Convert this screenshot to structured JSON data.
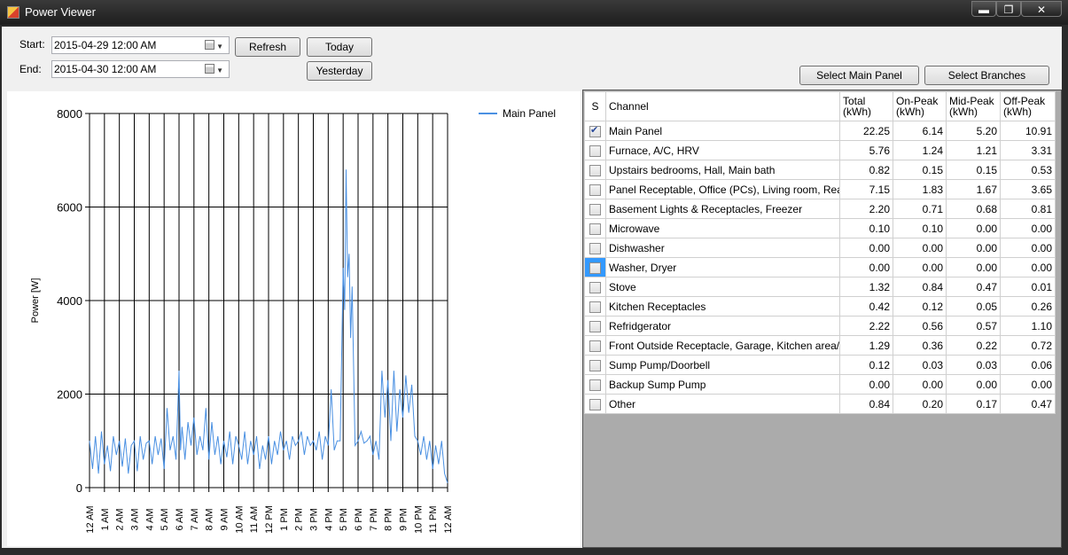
{
  "window": {
    "title": "Power Viewer",
    "min": "▬",
    "max": "❐",
    "close": "✕"
  },
  "controls": {
    "start_label": "Start:",
    "start_value": "2015-04-29 12:00 AM",
    "end_label": "End:",
    "end_value": "2015-04-30 12:00 AM",
    "refresh": "Refresh",
    "today": "Today",
    "yesterday": "Yesterday",
    "select_main": "Select Main Panel",
    "select_branches": "Select Branches"
  },
  "table": {
    "headers": [
      "S",
      "Channel",
      "Total\n(kWh)",
      "On-Peak\n(kWh)",
      "Mid-Peak\n(kWh)",
      "Off-Peak\n(kWh)"
    ],
    "rows": [
      {
        "checked": true,
        "channel": "Main Panel",
        "total": "22.25",
        "on": "6.14",
        "mid": "5.20",
        "off": "10.91"
      },
      {
        "checked": false,
        "channel": "Furnace, A/C, HRV",
        "total": "5.76",
        "on": "1.24",
        "mid": "1.21",
        "off": "3.31"
      },
      {
        "checked": false,
        "channel": "Upstairs bedrooms, Hall, Main bath",
        "total": "0.82",
        "on": "0.15",
        "mid": "0.15",
        "off": "0.53"
      },
      {
        "checked": false,
        "channel": "Panel Receptable, Office (PCs), Living room, Rear li...",
        "total": "7.15",
        "on": "1.83",
        "mid": "1.67",
        "off": "3.65"
      },
      {
        "checked": false,
        "channel": "Basement Lights & Receptacles, Freezer",
        "total": "2.20",
        "on": "0.71",
        "mid": "0.68",
        "off": "0.81"
      },
      {
        "checked": false,
        "channel": "Microwave",
        "total": "0.10",
        "on": "0.10",
        "mid": "0.00",
        "off": "0.00"
      },
      {
        "checked": false,
        "channel": "Dishwasher",
        "total": "0.00",
        "on": "0.00",
        "mid": "0.00",
        "off": "0.00"
      },
      {
        "checked": false,
        "channel": "Washer, Dryer",
        "total": "0.00",
        "on": "0.00",
        "mid": "0.00",
        "off": "0.00",
        "selected": true
      },
      {
        "checked": false,
        "channel": "Stove",
        "total": "1.32",
        "on": "0.84",
        "mid": "0.47",
        "off": "0.01"
      },
      {
        "checked": false,
        "channel": "Kitchen Receptacles",
        "total": "0.42",
        "on": "0.12",
        "mid": "0.05",
        "off": "0.26"
      },
      {
        "checked": false,
        "channel": "Refridgerator",
        "total": "2.22",
        "on": "0.56",
        "mid": "0.57",
        "off": "1.10"
      },
      {
        "checked": false,
        "channel": "Front Outside Receptacle, Garage, Kitchen area/fro...",
        "total": "1.29",
        "on": "0.36",
        "mid": "0.22",
        "off": "0.72"
      },
      {
        "checked": false,
        "channel": "Sump Pump/Doorbell",
        "total": "0.12",
        "on": "0.03",
        "mid": "0.03",
        "off": "0.06"
      },
      {
        "checked": false,
        "channel": "Backup Sump Pump",
        "total": "0.00",
        "on": "0.00",
        "mid": "0.00",
        "off": "0.00"
      },
      {
        "checked": false,
        "channel": "Other",
        "total": "0.84",
        "on": "0.20",
        "mid": "0.17",
        "off": "0.47"
      }
    ]
  },
  "chart_data": {
    "type": "line",
    "ylabel": "Power [W]",
    "ylim": [
      0,
      8000
    ],
    "yticks": [
      "0",
      "2000",
      "4000",
      "6000",
      "8000"
    ],
    "xticks": [
      "12 AM",
      "1 AM",
      "2 AM",
      "3 AM",
      "4 AM",
      "5 AM",
      "6 AM",
      "7 AM",
      "8 AM",
      "9 AM",
      "10 AM",
      "11 AM",
      "12 PM",
      "1 PM",
      "2 PM",
      "3 PM",
      "4 PM",
      "5 PM",
      "6 PM",
      "7 PM",
      "8 PM",
      "9 PM",
      "10 PM",
      "11 PM",
      "12 AM"
    ],
    "legend": "top-right",
    "grid": true,
    "color": "#4a90e2",
    "series": [
      {
        "name": "Main Panel",
        "x_hours": [
          0,
          0.2,
          0.4,
          0.6,
          0.8,
          1.0,
          1.2,
          1.4,
          1.6,
          1.8,
          2.0,
          2.2,
          2.4,
          2.6,
          2.8,
          3.0,
          3.2,
          3.4,
          3.6,
          3.8,
          4.0,
          4.2,
          4.4,
          4.6,
          4.8,
          5.0,
          5.2,
          5.4,
          5.6,
          5.8,
          6.0,
          6.1,
          6.2,
          6.4,
          6.6,
          6.8,
          7.0,
          7.2,
          7.4,
          7.6,
          7.8,
          8.0,
          8.2,
          8.4,
          8.6,
          8.8,
          9.0,
          9.2,
          9.4,
          9.6,
          9.8,
          10.0,
          10.2,
          10.4,
          10.6,
          10.8,
          11.0,
          11.2,
          11.4,
          11.6,
          11.8,
          12.0,
          12.2,
          12.4,
          12.6,
          12.8,
          13.0,
          13.2,
          13.4,
          13.6,
          13.8,
          14.0,
          14.2,
          14.4,
          14.6,
          14.8,
          15.0,
          15.2,
          15.4,
          15.6,
          15.8,
          16.0,
          16.2,
          16.4,
          16.6,
          16.8,
          17.0,
          17.1,
          17.2,
          17.3,
          17.4,
          17.5,
          17.6,
          17.8,
          18.0,
          18.2,
          18.4,
          18.6,
          18.8,
          19.0,
          19.2,
          19.4,
          19.6,
          19.8,
          20.0,
          20.2,
          20.4,
          20.6,
          20.8,
          21.0,
          21.2,
          21.4,
          21.6,
          21.8,
          22.0,
          22.2,
          22.4,
          22.6,
          22.8,
          23.0,
          23.2,
          23.4,
          23.6,
          23.8,
          24.0
        ],
        "y": [
          1000,
          400,
          1100,
          300,
          1200,
          500,
          900,
          350,
          1100,
          700,
          1000,
          450,
          1050,
          300,
          900,
          1000,
          350,
          1100,
          600,
          950,
          1000,
          500,
          1100,
          700,
          1050,
          400,
          1700,
          800,
          1100,
          600,
          2500,
          800,
          1300,
          600,
          1400,
          900,
          1500,
          700,
          1100,
          800,
          1700,
          600,
          1400,
          700,
          1100,
          500,
          1000,
          650,
          1200,
          500,
          1100,
          900,
          600,
          1200,
          500,
          1000,
          700,
          1100,
          400,
          900,
          600,
          1100,
          500,
          1000,
          700,
          1200,
          800,
          1000,
          600,
          1100,
          900,
          1000,
          1200,
          700,
          1100,
          900,
          1000,
          800,
          1200,
          600,
          1100,
          900,
          2100,
          800,
          1000,
          1000,
          4700,
          3800,
          6800,
          4500,
          5000,
          3200,
          4300,
          900,
          1000,
          1200,
          950,
          1000,
          1100,
          700,
          1000,
          600,
          2500,
          1500,
          2300,
          1000,
          2500,
          1200,
          2100,
          1500,
          2400,
          1600,
          2200,
          1100,
          1000,
          700,
          1100,
          600,
          1000,
          400,
          900,
          500,
          1000,
          300,
          100
        ]
      }
    ]
  }
}
